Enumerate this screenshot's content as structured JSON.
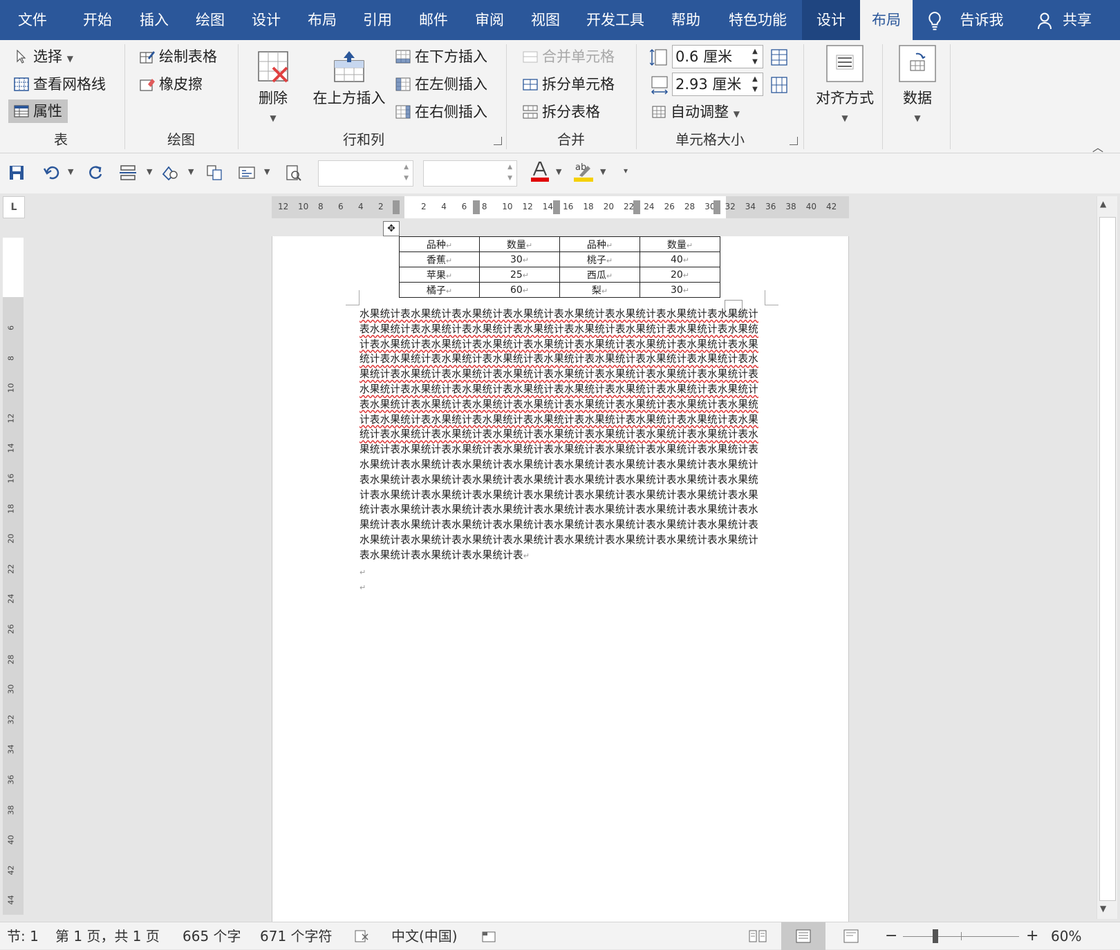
{
  "menu": {
    "tabs": [
      "文件",
      "开始",
      "插入",
      "绘图",
      "设计",
      "布局",
      "引用",
      "邮件",
      "审阅",
      "视图",
      "开发工具",
      "帮助",
      "特色功能"
    ],
    "context_tabs": [
      "设计",
      "布局"
    ],
    "tell_me": "告诉我",
    "share": "共享"
  },
  "ribbon": {
    "table_group": {
      "label": "表",
      "select": "选择",
      "gridlines": "查看网格线",
      "properties": "属性"
    },
    "draw_group": {
      "label": "绘图",
      "draw_table": "绘制表格",
      "eraser": "橡皮擦"
    },
    "rows_cols_group": {
      "label": "行和列",
      "delete": "删除",
      "insert_above": "在上方插入",
      "insert_below": "在下方插入",
      "insert_left": "在左侧插入",
      "insert_right": "在右侧插入"
    },
    "merge_group": {
      "label": "合并",
      "merge_cells": "合并单元格",
      "split_cells": "拆分单元格",
      "split_table": "拆分表格"
    },
    "cell_size_group": {
      "label": "单元格大小",
      "height": "0.6 厘米",
      "width": "2.93 厘米",
      "autofit": "自动调整"
    },
    "alignment": "对齐方式",
    "data": "数据"
  },
  "ruler": {
    "left_numbers": [
      "12",
      "10",
      "8",
      "6",
      "4",
      "2"
    ],
    "right_numbers": [
      "2",
      "4",
      "6",
      "8",
      "10",
      "12",
      "14",
      "16",
      "18",
      "20",
      "22",
      "24",
      "26",
      "28",
      "30",
      "32",
      "34",
      "36",
      "38",
      "40",
      "42"
    ],
    "vertical_numbers": [
      "6",
      "8",
      "10",
      "12",
      "14",
      "16",
      "18",
      "20",
      "22",
      "24",
      "26",
      "28",
      "30",
      "32",
      "34",
      "36",
      "38",
      "40",
      "42",
      "44"
    ]
  },
  "table": {
    "rows": [
      [
        "品种",
        "数量",
        "品种",
        "数量"
      ],
      [
        "香蕉",
        "30",
        "桃子",
        "40"
      ],
      [
        "苹果",
        "25",
        "西瓜",
        "20"
      ],
      [
        "橘子",
        "60",
        "梨",
        "30"
      ]
    ]
  },
  "paragraph": {
    "lines": [
      "水果统计表水果统计表水果统计表水果统计表水果统计表水果统计表水果统计表水果统计",
      "表水果统计表水果统计表水果统计表水果统计表水果统计表水果统计表水果统计表水果统",
      "计表水果统计表水果统计表水果统计表水果统计表水果统计表水果统计表水果统计表水果",
      "统计表水果统计表水果统计表水果统计表水果统计表水果统计表水果统计表水果统计表水",
      "果统计表水果统计表水果统计表水果统计表水果统计表水果统计表水果统计表水果统计表",
      "水果统计表水果统计表水果统计表水果统计表水果统计表水果统计表水果统计表水果统计",
      "表水果统计表水果统计表水果统计表水果统计表水果统计表水果统计表水果统计表水果统",
      "计表水果统计表水果统计表水果统计表水果统计表水果统计表水果统计表水果统计表水果",
      "统计表水果统计表水果统计表水果统计表水果统计表水果统计表水果统计表水果统计表水",
      "果统计表水果统计表水果统计表水果统计表水果统计表水果统计表水果统计表水果统计表",
      "水果统计表水果统计表水果统计表水果统计表水果统计表水果统计表水果统计表水果统计",
      "表水果统计表水果统计表水果统计表水果统计表水果统计表水果统计表水果统计表水果统",
      "计表水果统计表水果统计表水果统计表水果统计表水果统计表水果统计表水果统计表水果",
      "统计表水果统计表水果统计表水果统计表水果统计表水果统计表水果统计表水果统计表水",
      "果统计表水果统计表水果统计表水果统计表水果统计表水果统计表水果统计表水果统计表",
      "水果统计表水果统计表水果统计表水果统计表水果统计表水果统计表水果统计表水果统计",
      "表水果统计表水果统计表水果统计表"
    ]
  },
  "status": {
    "section": "节: 1",
    "page": "第 1 页，共 1 页",
    "words": "665 个字",
    "chars": "671 个字符",
    "language": "中文(中国)",
    "zoom": "60%"
  },
  "colors": {
    "brand": "#2b579a",
    "context_tab": "#1f4580",
    "spell_error": "#d33333",
    "font_color": "#e00000",
    "highlight": "#f5d000"
  }
}
